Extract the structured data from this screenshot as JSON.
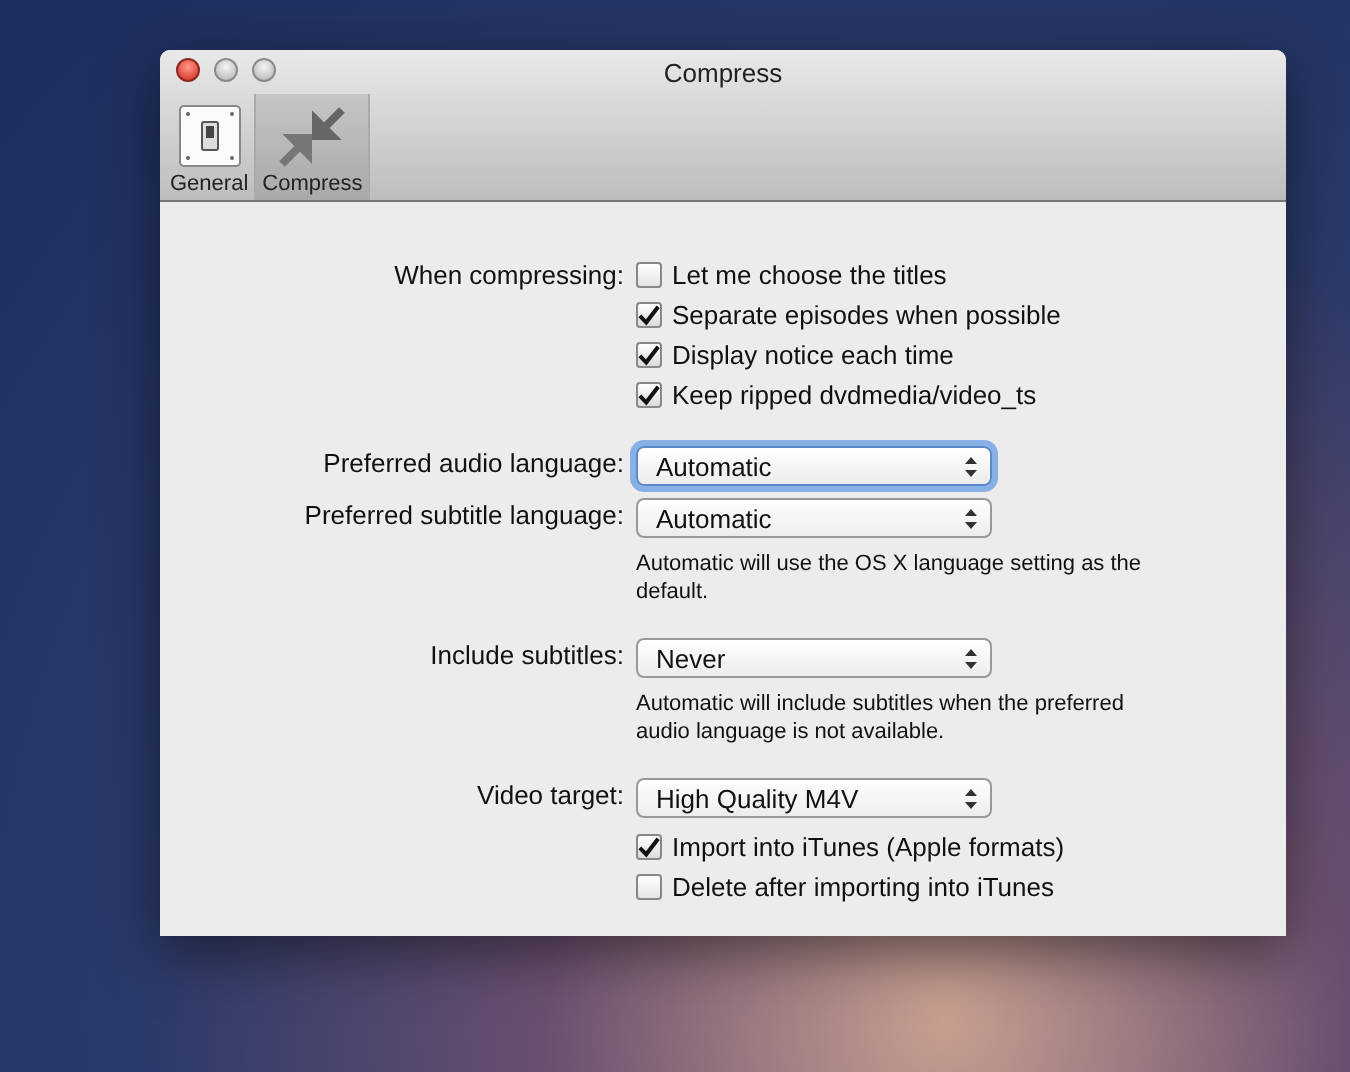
{
  "window": {
    "title": "Compress"
  },
  "toolbar": [
    {
      "label": "General",
      "kind": "switch",
      "selected": false
    },
    {
      "label": "Compress",
      "kind": "compress",
      "selected": true
    }
  ],
  "rows": [
    {
      "kind": "checks",
      "label": "When compressing:",
      "items": [
        {
          "label": "Let me choose the titles",
          "checked": false
        },
        {
          "label": "Separate episodes when possible",
          "checked": true
        },
        {
          "label": "Display notice each time",
          "checked": true
        },
        {
          "label": "Keep ripped dvdmedia/video_ts",
          "checked": true
        }
      ]
    },
    {
      "kind": "gap"
    },
    {
      "kind": "popup",
      "label": "Preferred audio language:",
      "value": "Automatic",
      "focused": true
    },
    {
      "kind": "popup",
      "label": "Preferred subtitle language:",
      "value": "Automatic",
      "focused": false
    },
    {
      "kind": "note",
      "text": "Automatic will use the OS X language setting as the default."
    },
    {
      "kind": "gap"
    },
    {
      "kind": "popup",
      "label": "Include subtitles:",
      "value": "Never",
      "focused": false
    },
    {
      "kind": "note",
      "text": "Automatic will include subtitles when the preferred audio language is not available."
    },
    {
      "kind": "gap"
    },
    {
      "kind": "popup",
      "label": "Video target:",
      "value": "High Quality M4V",
      "focused": false
    },
    {
      "kind": "checks",
      "items": [
        {
          "label": "Import into iTunes (Apple formats)",
          "checked": true
        },
        {
          "label": "Delete after importing into iTunes",
          "checked": false
        }
      ]
    }
  ]
}
